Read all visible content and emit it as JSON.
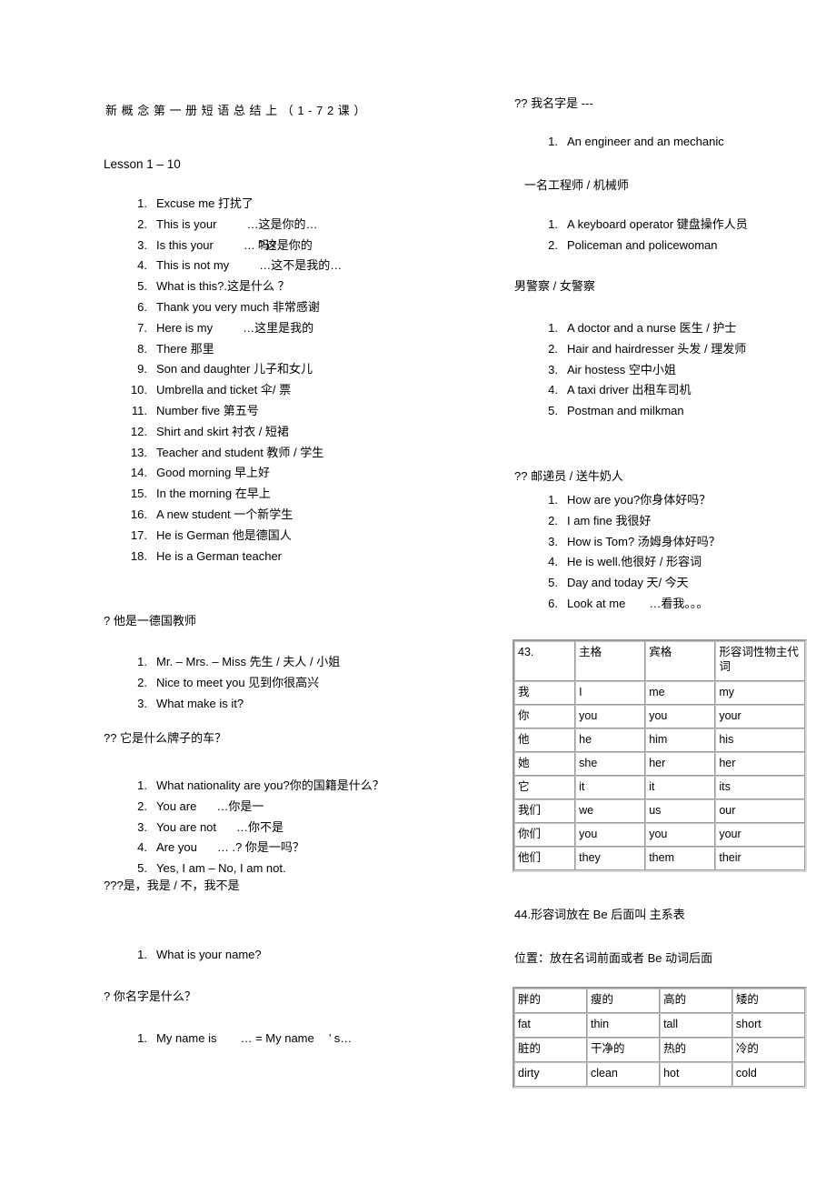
{
  "document": {
    "title_chars": [
      "新",
      "概",
      "念",
      "第",
      "一",
      "册",
      "",
      "短",
      "语",
      "总",
      "结",
      "",
      "上",
      "（",
      "1",
      "-",
      "7",
      "2",
      "",
      "课",
      "）"
    ],
    "title_plain": "新 概 念 第 一 册  短 语 总 结  上 （ 1 - 7 2  课 ）",
    "lesson_heading": "Lesson 1 –  10"
  },
  "left_column": {
    "list1": [
      {
        "num": "1.",
        "text": "Excuse me 打扰了"
      },
      {
        "num": "2.",
        "text": "This is your",
        "tail": "…这是你的…"
      },
      {
        "num": "3.",
        "text": "Is this your",
        "tail": "… ?这是你的",
        "overlay": "吗?"
      },
      {
        "num": "4.",
        "text": "This is not my",
        "tail": "…这不是我的…"
      },
      {
        "num": "5.",
        "text": "What is this?.这是什么 ？"
      },
      {
        "num": "6.",
        "text": "Thank you very much  非常感谢"
      },
      {
        "num": "7.",
        "text": "Here is my",
        "tail": "…这里是我的"
      },
      {
        "num": "8.",
        "text": "There 那里"
      },
      {
        "num": "9.",
        "text": "Son and daughter 儿子和女儿"
      },
      {
        "num": "10.",
        "text": "Umbrella and ticket 伞/ 票"
      },
      {
        "num": "11.",
        "text": "Number five  第五号"
      },
      {
        "num": "12.",
        "text": "Shirt and skirt 衬衣 / 短裙"
      },
      {
        "num": "13.",
        "text": "Teacher and student 教师 / 学生"
      },
      {
        "num": "14.",
        "text": "Good morning  早上好"
      },
      {
        "num": "15.",
        "text": "In the morning  在早上"
      },
      {
        "num": "16.",
        "text": "A new student 一个新学生"
      },
      {
        "num": "17.",
        "text": "He is German 他是德国人"
      },
      {
        "num": "18.",
        "text": "He is a German teacher"
      }
    ],
    "note1": "? 他是一德国教师",
    "list2": [
      {
        "num": "1.",
        "text": "Mr.  –  Mrs.  –  Miss 先生 / 夫人 / 小姐"
      },
      {
        "num": "2.",
        "text": "Nice to meet you  见到你很高兴"
      },
      {
        "num": "3.",
        "text": "What make is it?"
      }
    ],
    "note2": "?? 它是什么牌子的车？",
    "list3": [
      {
        "num": "1.",
        "text": "What nationality are you?你的国籍是什么？"
      },
      {
        "num": "2.",
        "text": "You are",
        "tail": "…你是一"
      },
      {
        "num": "3.",
        "text": "You are not",
        "tail": "…你不是"
      },
      {
        "num": "4.",
        "text": "Are you",
        "tail": "… .? 你是一吗？"
      },
      {
        "num": "5.",
        "text": "Yes, I am  –  No, I am not."
      }
    ],
    "note3": "???是，我是 / 不，我不是",
    "list4": [
      {
        "num": "1.",
        "text": "What is your name?"
      }
    ],
    "note4": "? 你名字是什么？",
    "list5": [
      {
        "num": "1.",
        "text": "My name is",
        "tail": "… = My name",
        "tail2": "’  s…"
      }
    ]
  },
  "right_column": {
    "note0": "?? 我名字是 ---",
    "list1": [
      {
        "num": "1.",
        "text": "An engineer and an mechanic"
      }
    ],
    "note1": "一名工程师 / 机械师",
    "list2": [
      {
        "num": "1.",
        "text": "A keyboard operator  键盘操作人员"
      },
      {
        "num": "2.",
        "text": "Policeman and policewoman"
      }
    ],
    "note2": "男警察 /  女警察",
    "list3": [
      {
        "num": "1.",
        "text": "A doctor and a nurse 医生 / 护士"
      },
      {
        "num": "2.",
        "text": "Hair and hairdresser 头发 / 理发师"
      },
      {
        "num": "3.",
        "text": "Air hostess 空中小姐"
      },
      {
        "num": "4.",
        "text": "A taxi driver  出租车司机"
      },
      {
        "num": "5.",
        "text": "Postman and milkman"
      }
    ],
    "note3": "?? 邮递员 / 送牛奶人",
    "list4": [
      {
        "num": "1.",
        "text": "How are you?你身体好吗？"
      },
      {
        "num": "2.",
        "text": "I am fine 我很好"
      },
      {
        "num": "3.",
        "text": "How is Tom? 汤姆身体好吗？"
      },
      {
        "num": "4.",
        "text": "He is well.他很好 / 形容词"
      },
      {
        "num": "5.",
        "text": "Day and today 天/ 今天"
      },
      {
        "num": "6.",
        "text": "Look at me",
        "tail": "…看我。。。"
      }
    ],
    "pronoun_table": {
      "rows": [
        [
          "43.",
          "主格",
          "宾格",
          "形容词性物主代词"
        ],
        [
          "我",
          "I",
          "me",
          "my"
        ],
        [
          "你",
          "you",
          "you",
          "your"
        ],
        [
          "他",
          "he",
          "him",
          "his"
        ],
        [
          "她",
          "she",
          "her",
          "her"
        ],
        [
          "它",
          "it",
          "it",
          "its"
        ],
        [
          "我们",
          "we",
          "us",
          "our"
        ],
        [
          "你们",
          "you",
          "you",
          "your"
        ],
        [
          "他们",
          "they",
          "them",
          "their"
        ]
      ]
    },
    "note44": "44.形容词放在  Be 后面叫 主系表",
    "note45": "位置：放在名词前面或者     Be 动词后面",
    "adj_table": {
      "rows": [
        [
          "胖的",
          "瘦的",
          "高的",
          "矮的"
        ],
        [
          "fat",
          "thin",
          "tall",
          "short"
        ],
        [
          "脏的",
          "干净的",
          "热的",
          "冷的"
        ],
        [
          "dirty",
          "clean",
          "hot",
          "cold"
        ]
      ]
    }
  }
}
